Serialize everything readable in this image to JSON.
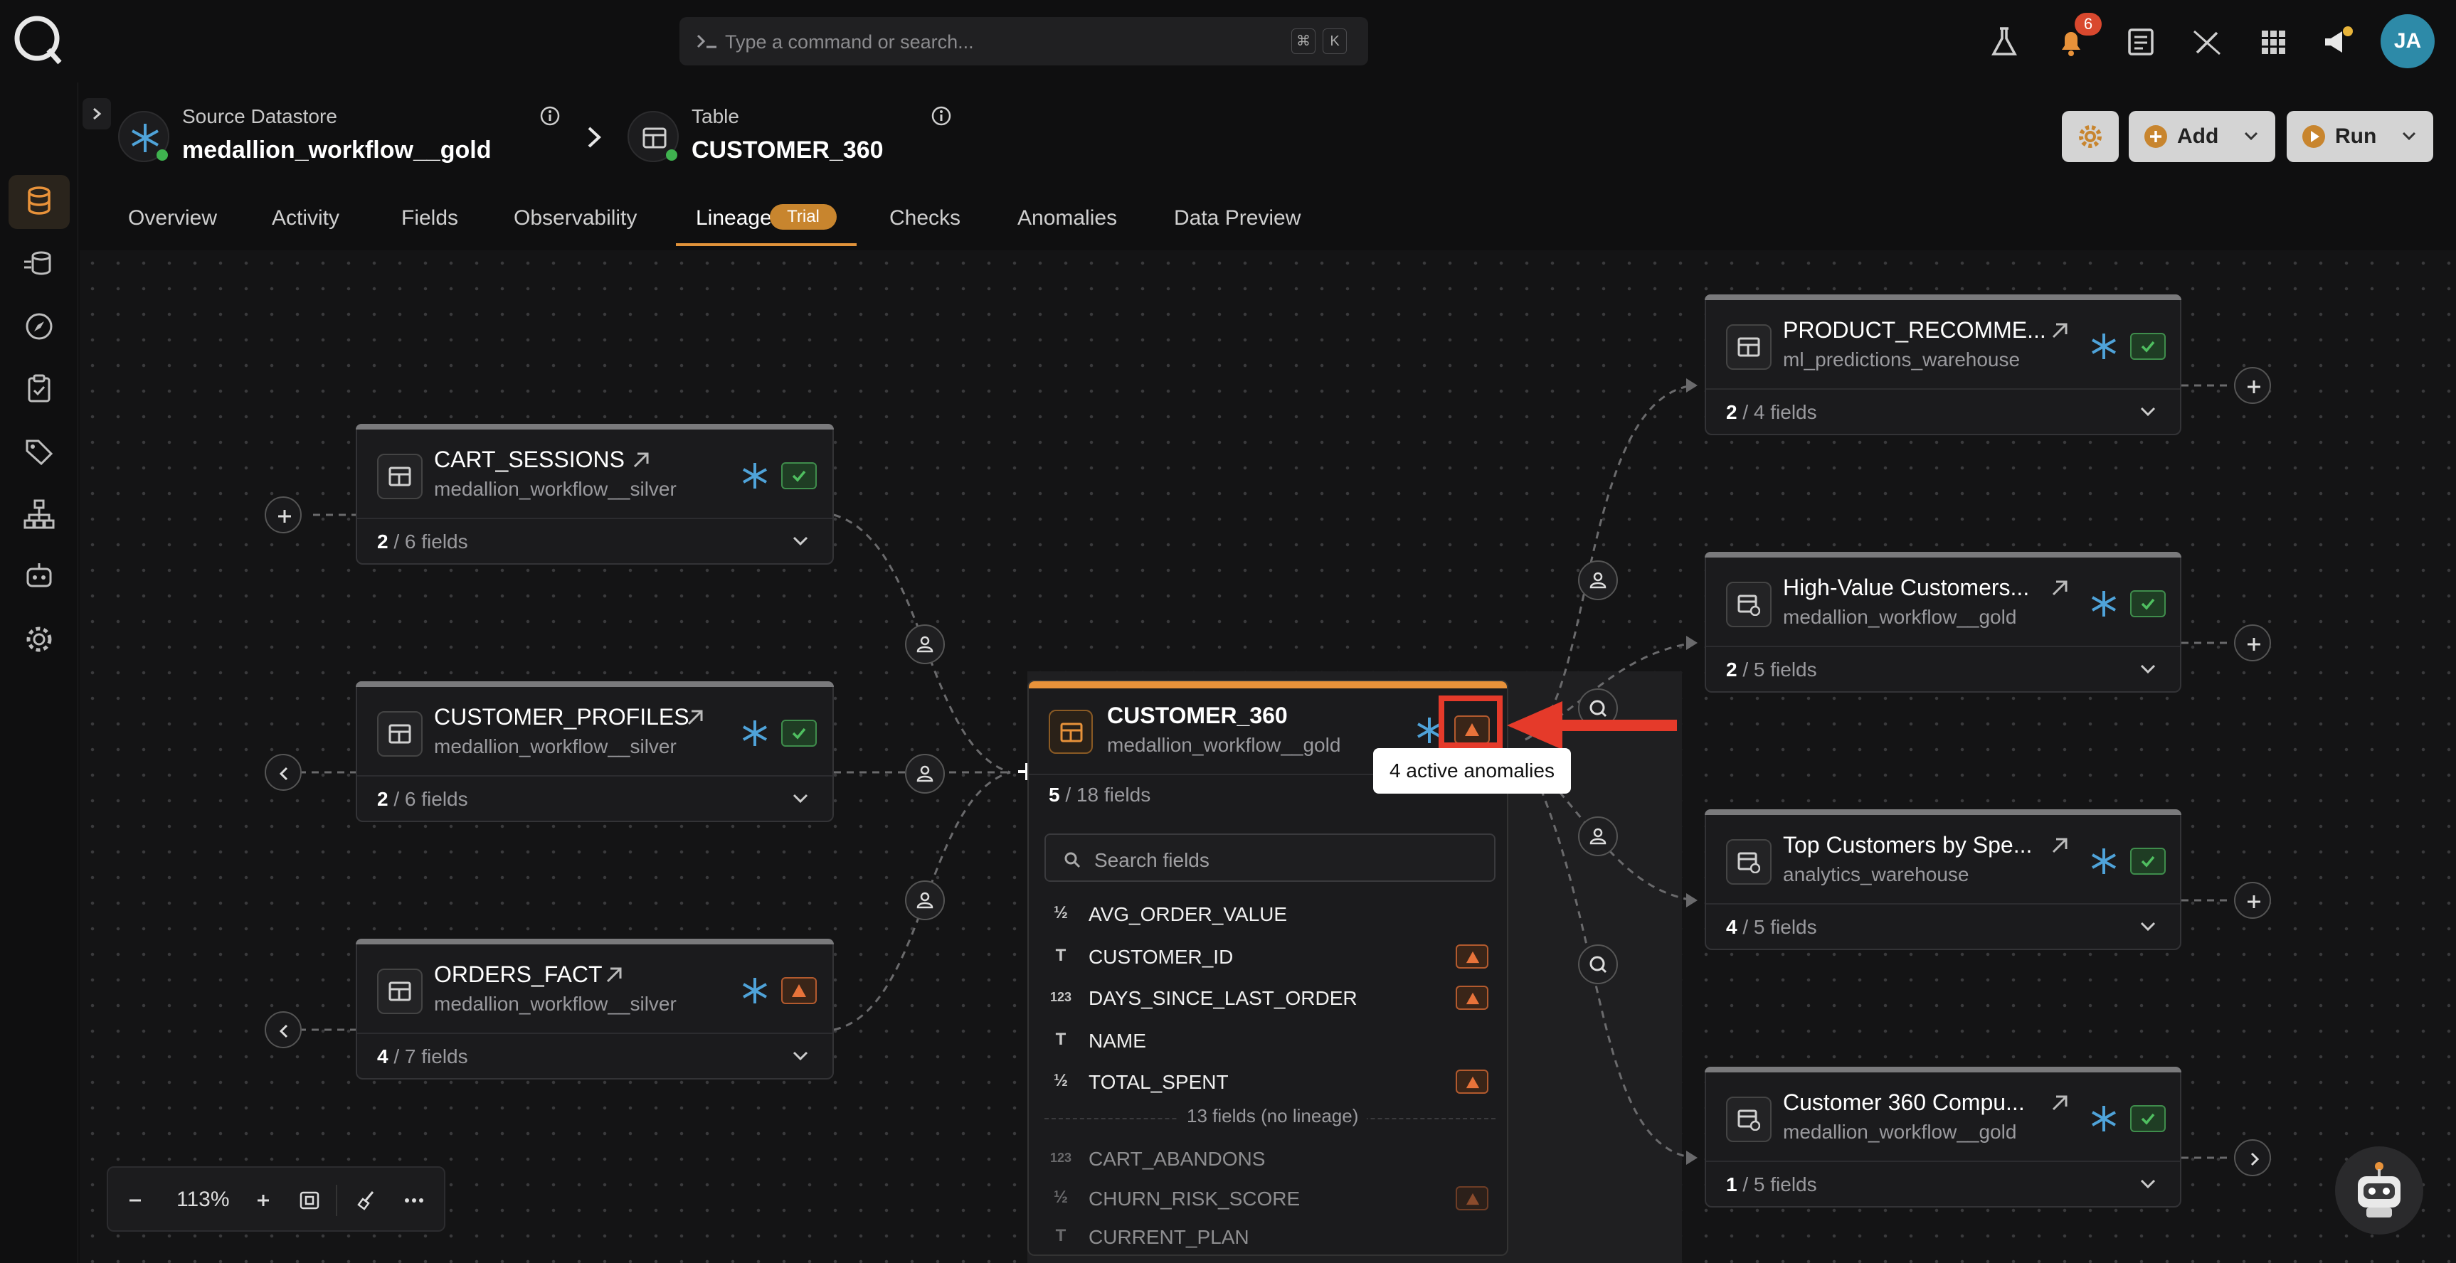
{
  "command": {
    "placeholder": "Type a command or search...",
    "shortcut_1": "⌘",
    "shortcut_2": "K"
  },
  "topbar": {
    "notification_count": "6",
    "avatar_initials": "JA"
  },
  "header": {
    "source_label": "Source Datastore",
    "source_name": "medallion_workflow__gold",
    "table_label": "Table",
    "table_name": "CUSTOMER_360",
    "add_label": "Add",
    "run_label": "Run"
  },
  "tabs": [
    "Overview",
    "Activity",
    "Fields",
    "Observability",
    "Lineage",
    "Checks",
    "Anomalies",
    "Data Preview"
  ],
  "trial_label": "Trial",
  "nodes": {
    "cart_sessions": {
      "title": "CART_SESSIONS",
      "sub": "medallion_workflow__silver",
      "count": "2",
      "total": " / 6 fields"
    },
    "customer_profiles": {
      "title": "CUSTOMER_PROFILES",
      "sub": "medallion_workflow__silver",
      "count": "2",
      "total": " / 6 fields"
    },
    "orders_fact": {
      "title": "ORDERS_FACT",
      "sub": "medallion_workflow__silver",
      "count": "4",
      "total": " / 7 fields"
    },
    "product_recomme": {
      "title": "PRODUCT_RECOMME...",
      "sub": "ml_predictions_warehouse",
      "count": "2",
      "total": " / 4 fields"
    },
    "high_value": {
      "title": "High-Value Customers...",
      "sub": "medallion_workflow__gold",
      "count": "2",
      "total": " / 5 fields"
    },
    "top_customers": {
      "title": "Top Customers by Spe...",
      "sub": "analytics_warehouse",
      "count": "4",
      "total": " / 5 fields"
    },
    "customer_360_compu": {
      "title": "Customer 360 Compu...",
      "sub": "medallion_workflow__gold",
      "count": "1",
      "total": " / 5 fields"
    }
  },
  "focus": {
    "title": "CUSTOMER_360",
    "sub": "medallion_workflow__gold",
    "count": "5",
    "total": " / 18 fields",
    "search_placeholder": "Search fields",
    "fields": [
      {
        "type": "½",
        "name": "AVG_ORDER_VALUE",
        "warn": false
      },
      {
        "type": "T",
        "name": "CUSTOMER_ID",
        "warn": true
      },
      {
        "type": "123",
        "name": "DAYS_SINCE_LAST_ORDER",
        "warn": true
      },
      {
        "type": "T",
        "name": "NAME",
        "warn": false
      },
      {
        "type": "½",
        "name": "TOTAL_SPENT",
        "warn": true
      }
    ],
    "no_lineage_label": "13 fields (no lineage)",
    "extra_fields": [
      {
        "type": "123",
        "name": "CART_ABANDONS",
        "warn": false
      },
      {
        "type": "½",
        "name": "CHURN_RISK_SCORE",
        "warn": true
      },
      {
        "type": "T",
        "name": "CURRENT_PLAN",
        "warn": false
      }
    ]
  },
  "tooltip": "4 active anomalies",
  "zoom": {
    "level": "113%"
  },
  "colors": {
    "accent": "#e8923a",
    "ok": "#3f8d4c",
    "warn": "#b35a2e",
    "highlight": "#e53a2a",
    "snowflake": "#4fa3d9"
  }
}
